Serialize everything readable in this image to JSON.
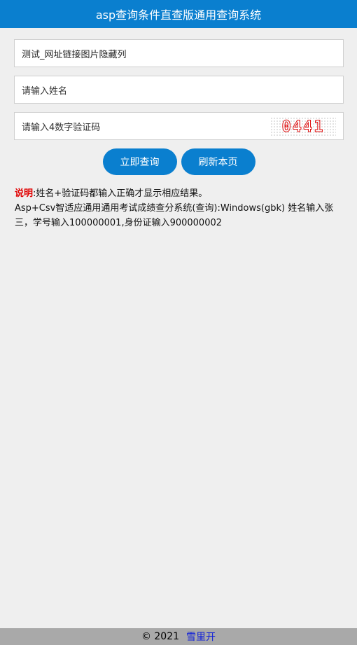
{
  "header": {
    "title": "asp查询条件直查版通用查询系统"
  },
  "form": {
    "field1_value": "测试_网址链接图片隐藏列",
    "name_placeholder": "请输入姓名",
    "code_placeholder": "请输入4数字验证码",
    "captcha_text": "0441"
  },
  "buttons": {
    "query_label": "立即查询",
    "refresh_label": "刷新本页"
  },
  "notes": {
    "label": "说明",
    "line1": ":姓名+验证码都输入正确才显示相应结果。",
    "line2": "Asp+Csv智适应通用通用考试成绩查分系统(查询):Windows(gbk) 姓名输入张三，学号输入100000001,身份证输入900000002"
  },
  "footer": {
    "copyright": "© 2021",
    "link_text": "雪里开"
  },
  "colors": {
    "primary": "#0a7fcf",
    "background": "#efefef",
    "footer_bg": "#a9a9a9",
    "captcha": "#e01010",
    "note_label": "#e00000",
    "link": "#1020d8"
  }
}
